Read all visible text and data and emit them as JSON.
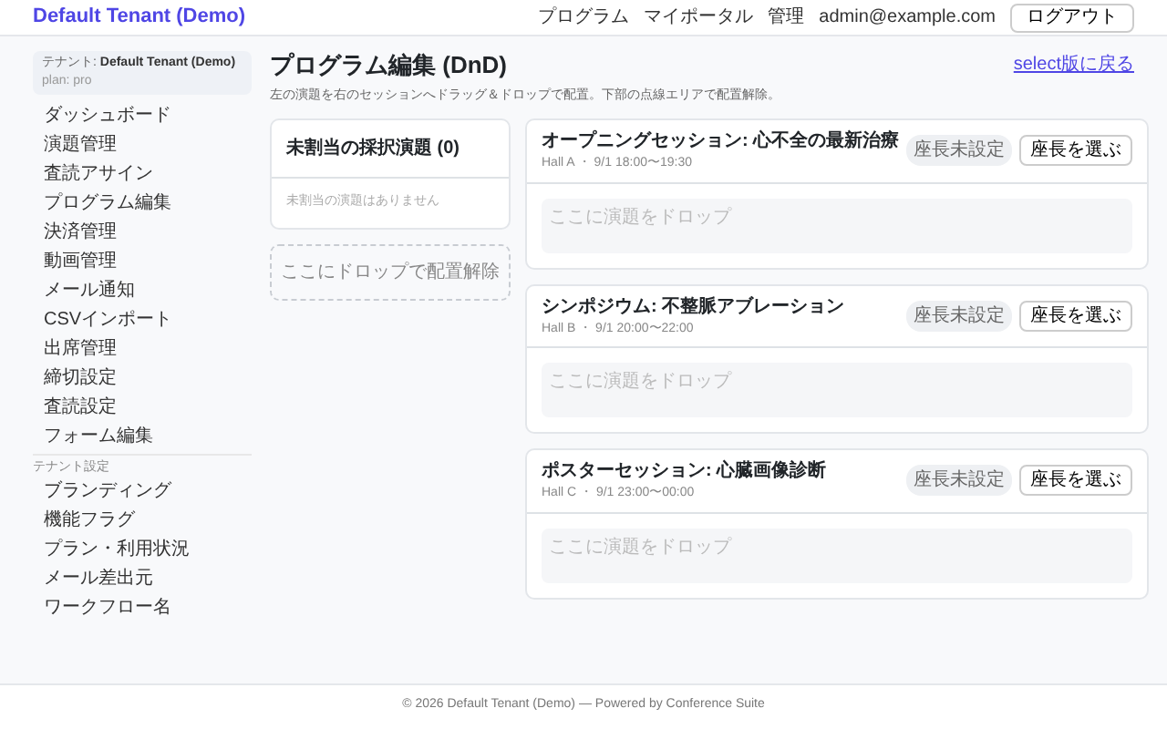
{
  "navbar": {
    "brand": "Default Tenant (Demo)",
    "links": [
      "プログラム",
      "マイポータル",
      "管理"
    ],
    "user": "admin@example.com",
    "logout": "ログアウト"
  },
  "sidebar": {
    "tenant": "テナント: **Default Tenant (Demo)**",
    "plan": "plan: pro",
    "items": [
      "ダッシュボード",
      "演題管理",
      "査読アサイン",
      "プログラム編集",
      "決済管理",
      "動画管理",
      "メール通知",
      "CSVインポート",
      "出席管理",
      "締切設定",
      "査読設定",
      "フォーム編集"
    ],
    "section_label": "テナント設定",
    "settings_items": [
      "ブランディング",
      "機能フラグ",
      "プラン・利用状況",
      "メール差出元",
      "ワークフロー名"
    ]
  },
  "page": {
    "title": "プログラム編集 (DnD)",
    "back_link": "select版に戻る",
    "description": "左の演題を右のセッションへドラッグ＆ドロップで配置。下部の点線エリアで配置解除。"
  },
  "unassigned": {
    "title": "未割当の採択演題 (0)",
    "empty": "未割当の演題はありません",
    "drop_zone": "ここにドロップで配置解除"
  },
  "sessions": [
    {
      "title": "オープニングセッション: 心不全の最新治療",
      "meta": "Hall A ・ 9/1 18:00〜19:30",
      "badge": "座長未設定",
      "button": "座長を選ぶ",
      "drop_placeholder": "ここに演題をドロップ"
    },
    {
      "title": "シンポジウム: 不整脈アブレーション",
      "meta": "Hall B ・ 9/1 20:00〜22:00",
      "badge": "座長未設定",
      "button": "座長を選ぶ",
      "drop_placeholder": "ここに演題をドロップ"
    },
    {
      "title": "ポスターセッション: 心臓画像診断",
      "meta": "Hall C ・ 9/1 23:00〜00:00",
      "badge": "座長未設定",
      "button": "座長を選ぶ",
      "drop_placeholder": "ここに演題をドロップ"
    }
  ],
  "footer": "© 2026 Default Tenant (Demo) — Powered by Conference Suite"
}
